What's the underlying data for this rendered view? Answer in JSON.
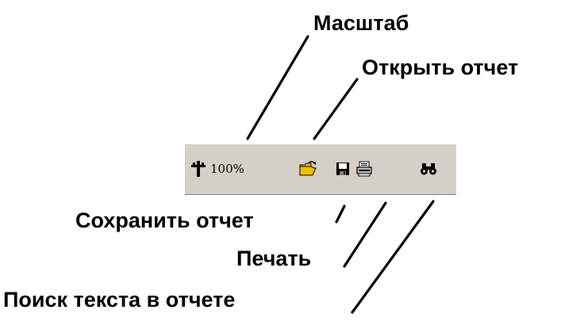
{
  "callouts": {
    "zoom": "Масштаб",
    "open_report": "Открыть отчет",
    "save_report": "Сохранить отчет",
    "print": "Печать",
    "find_text": "Поиск текста в отчете"
  },
  "toolbar": {
    "zoom_value": "100%",
    "icons": {
      "zoom": "zoom-pin-icon",
      "open": "folder-open-icon",
      "save": "floppy-disk-icon",
      "print": "printer-icon",
      "find": "binoculars-icon"
    }
  },
  "colors": {
    "toolbar_bg": "#d4d0c8",
    "folder": "#f0c000",
    "text": "#000000"
  }
}
